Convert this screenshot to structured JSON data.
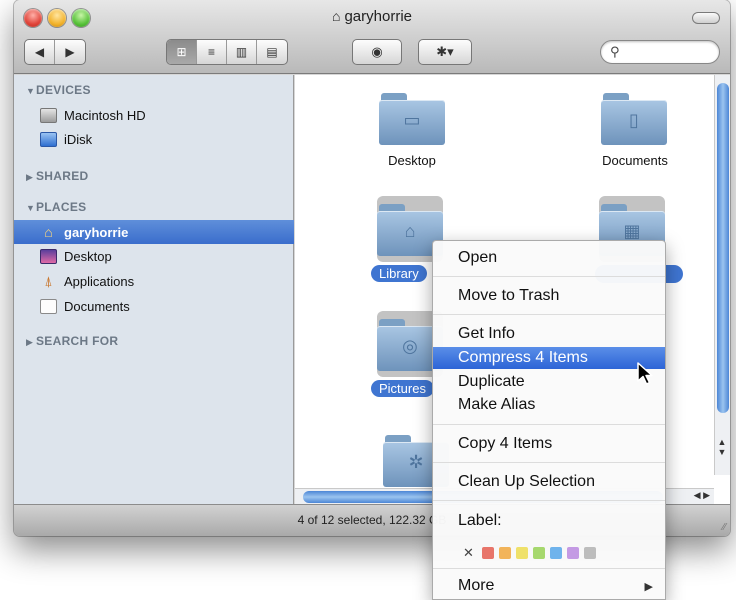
{
  "window": {
    "title": "garyhorrie"
  },
  "toolbar": {
    "view_modes": [
      "icon",
      "list",
      "column",
      "cover-flow"
    ],
    "selected_view": "icon"
  },
  "sidebar": {
    "sections": {
      "devices": "DEVICES",
      "shared": "SHARED",
      "places": "PLACES",
      "search_for": "SEARCH FOR"
    },
    "devices": [
      "Macintosh HD",
      "iDisk"
    ],
    "places": [
      "garyhorrie",
      "Desktop",
      "Applications",
      "Documents"
    ],
    "selected": "garyhorrie"
  },
  "content": {
    "items": [
      {
        "name": "Desktop",
        "selected": false
      },
      {
        "name": "Documents",
        "selected": false
      },
      {
        "name": "Library",
        "selected": true
      },
      {
        "name": "Pictures",
        "selected": true
      }
    ]
  },
  "status": {
    "text": "4 of 12 selected, 122.32 GB"
  },
  "context_menu": {
    "items": [
      "Open",
      "Move to Trash",
      "Get Info",
      "Compress 4 Items",
      "Duplicate",
      "Make Alias",
      "Copy 4 Items",
      "Clean Up Selection",
      "Label:",
      "More"
    ],
    "highlighted": "Compress 4 Items",
    "label_colors": [
      "#e8756a",
      "#f2b45a",
      "#efe16a",
      "#a6d86e",
      "#6fb3ec",
      "#c49ae4",
      "#bdbdbd"
    ]
  }
}
